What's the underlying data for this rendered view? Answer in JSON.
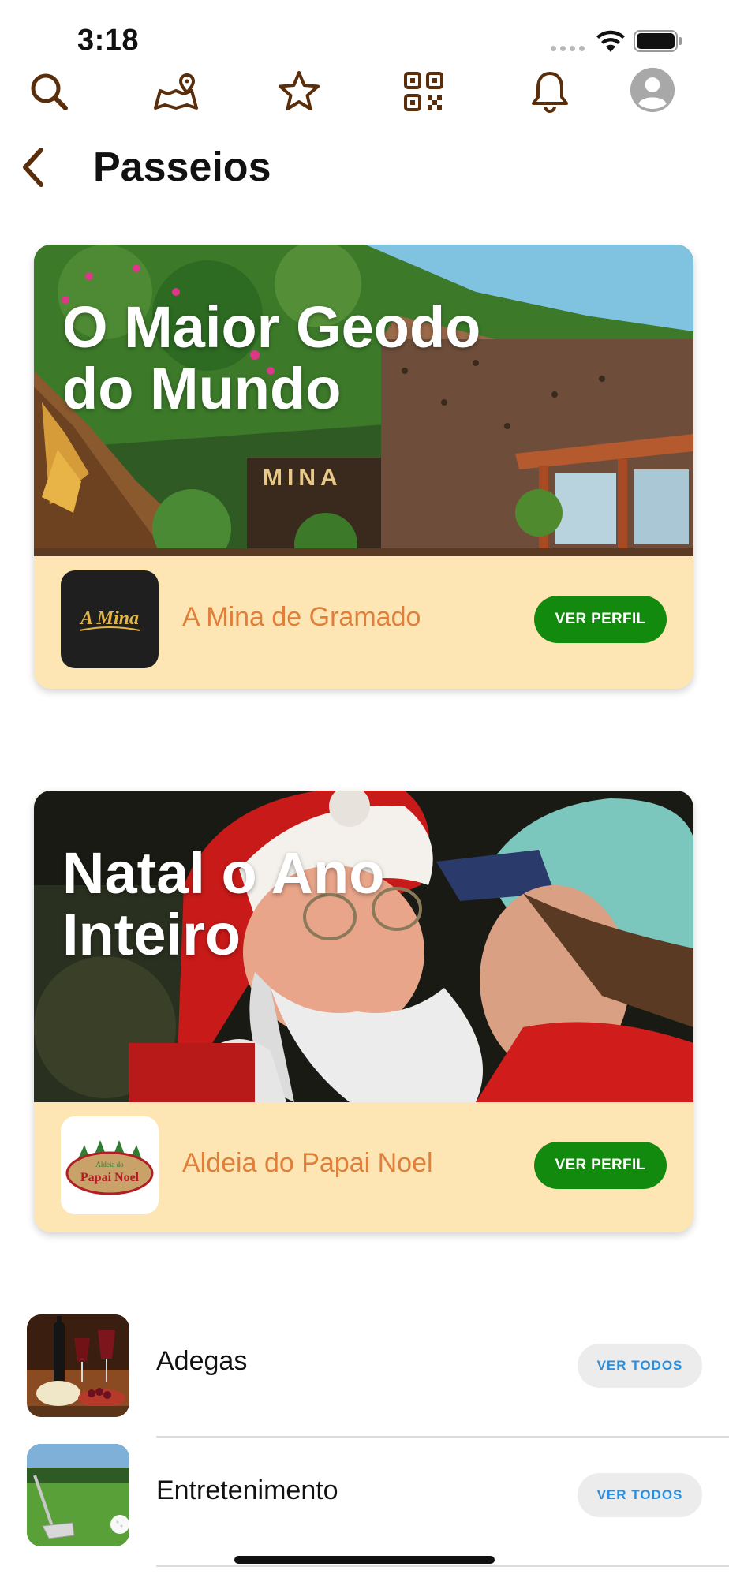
{
  "status_bar": {
    "time": "3:18"
  },
  "top_nav": {
    "icons": [
      "search-icon",
      "map-pin-icon",
      "star-icon",
      "qr-code-icon",
      "bell-icon",
      "profile-avatar-icon"
    ]
  },
  "header": {
    "title": "Passeios",
    "back_icon": "chevron-left-icon"
  },
  "featured": [
    {
      "headline": "O Maior Geodo do Mundo",
      "name": "A Mina de Gramado",
      "logo_text": "A Mina",
      "sign_text": "MINA",
      "button": "VER PERFIL"
    },
    {
      "headline": "Natal o Ano Inteiro",
      "name": "Aldeia do Papai Noel",
      "logo_text_small": "Aldeia do",
      "logo_text_big": "Papai Noel",
      "button": "VER PERFIL"
    }
  ],
  "categories": [
    {
      "label": "Adegas",
      "button": "VER TODOS"
    },
    {
      "label": "Entretenimento",
      "button": "VER TODOS"
    }
  ],
  "colors": {
    "accent_green": "#128a0d",
    "card_bg": "#fde6b4",
    "name_orange": "#e07f3a",
    "icon_brown": "#5a2e0a",
    "link_blue": "#2a8ee0"
  }
}
